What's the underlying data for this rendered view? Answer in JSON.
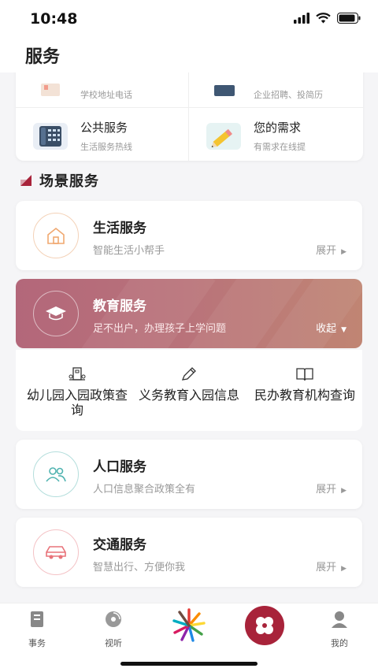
{
  "status_bar": {
    "time": "10:48"
  },
  "header": {
    "title": "服务"
  },
  "top_grid": [
    {
      "title": "",
      "subtitle": "学校地址电话",
      "icon": "school-icon"
    },
    {
      "title": "",
      "subtitle": "企业招聘、投简历",
      "icon": "briefcase-icon"
    },
    {
      "title": "公共服务",
      "subtitle": "生活服务热线",
      "icon": "phone-icon"
    },
    {
      "title": "您的需求",
      "subtitle": "有需求在线提",
      "icon": "pencil-icon"
    }
  ],
  "section": {
    "title": "场景服务"
  },
  "services": {
    "life": {
      "title": "生活服务",
      "subtitle": "智能生活小帮手",
      "toggle": "展开",
      "icon": "house-icon",
      "accent": "#f0a870"
    },
    "education": {
      "title": "教育服务",
      "subtitle": "足不出户，办理孩子上学问题",
      "toggle": "收起",
      "icon": "graduation-cap-icon"
    },
    "population": {
      "title": "人口服务",
      "subtitle": "人口信息聚合政策全有",
      "toggle": "展开",
      "icon": "people-icon",
      "accent": "#4fb3b0"
    },
    "traffic": {
      "title": "交通服务",
      "subtitle": "智慧出行、方便你我",
      "toggle": "展开",
      "icon": "car-icon",
      "accent": "#e8737a"
    }
  },
  "education_items": [
    {
      "label": "幼儿园入园政策查询",
      "icon": "kindergarten-icon"
    },
    {
      "label": "义务教育入园信息",
      "icon": "pencil-icon"
    },
    {
      "label": "民办教育机构查询",
      "icon": "book-icon"
    }
  ],
  "tabbar": [
    {
      "label": "事务",
      "icon": "clipboard-icon"
    },
    {
      "label": "视听",
      "icon": "disc-icon"
    },
    {
      "label": "",
      "icon": "logo-icon"
    },
    {
      "label": "",
      "icon": "four-petal-icon"
    },
    {
      "label": "我的",
      "icon": "user-icon"
    }
  ],
  "colors": {
    "brand": "#a8233a",
    "education_gradient": [
      "#b3677a",
      "#c08573"
    ]
  }
}
